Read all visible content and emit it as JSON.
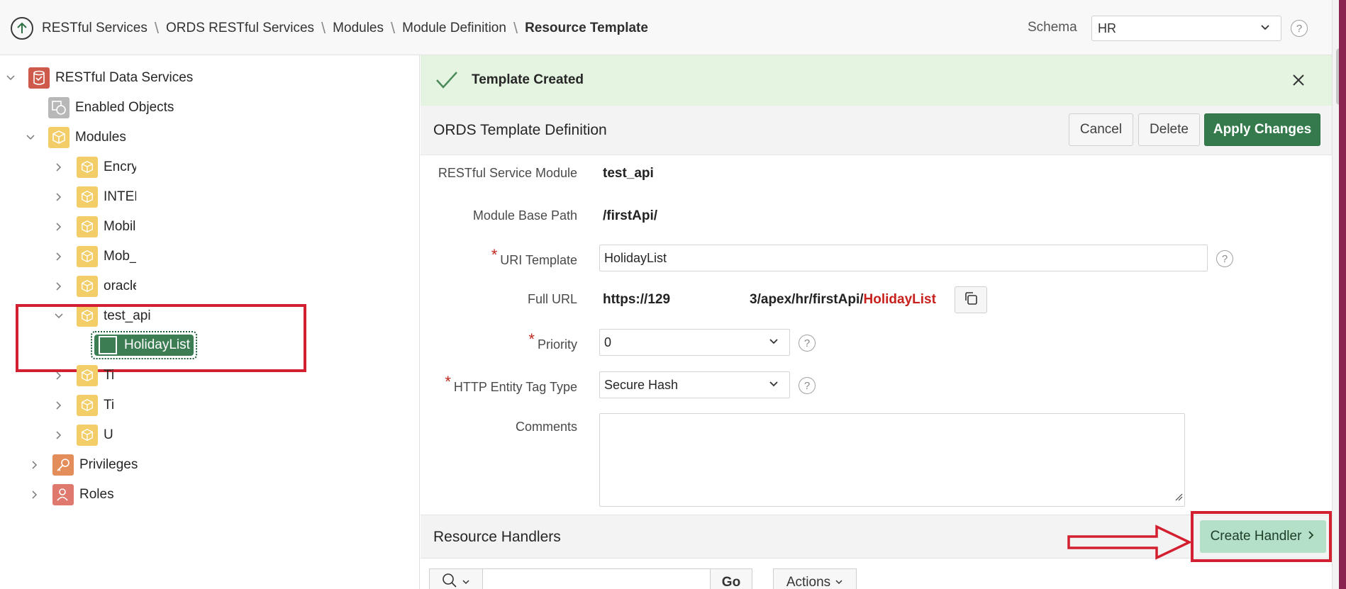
{
  "breadcrumb": {
    "items": [
      "RESTful Services",
      "ORDS RESTful Services",
      "Modules",
      "Module Definition"
    ],
    "current": "Resource Template"
  },
  "schema": {
    "label": "Schema",
    "value": "HR",
    "help": "?"
  },
  "tree": {
    "root": "RESTful Data Services",
    "enabled_objects": "Enabled Objects",
    "modules": "Modules",
    "module_items": [
      "Encry",
      "INTEF",
      "Mobil",
      "Mob_",
      "oracle"
    ],
    "expanded_module": "test_api",
    "template": "HolidayList",
    "after_items": [
      "Ti",
      "Ti",
      "U"
    ],
    "privileges": "Privileges",
    "roles": "Roles"
  },
  "alert": {
    "message": "Template Created"
  },
  "region": {
    "title": "ORDS Template Definition",
    "cancel": "Cancel",
    "delete": "Delete",
    "apply": "Apply Changes"
  },
  "form": {
    "module_label": "RESTful Service Module",
    "module_value": "test_api",
    "base_path_label": "Module Base Path",
    "base_path_value": "/firstApi/",
    "uri_label": "URI Template",
    "uri_value": "HolidayList",
    "full_url_label": "Full URL",
    "full_url_prefix": "https://129",
    "full_url_middle": "3/apex/hr/firstApi/",
    "full_url_template": "HolidayList",
    "priority_label": "Priority",
    "priority_value": "0",
    "etag_label": "HTTP Entity Tag Type",
    "etag_value": "Secure Hash",
    "comments_label": "Comments",
    "required_mark": "*",
    "help": "?"
  },
  "handlers": {
    "title": "Resource Handlers",
    "create": "Create Handler",
    "go": "Go",
    "actions": "Actions"
  },
  "colors": {
    "accent_green": "#347a4c",
    "alert_bg": "#e4f4e1",
    "highlight_red": "#d32030"
  }
}
